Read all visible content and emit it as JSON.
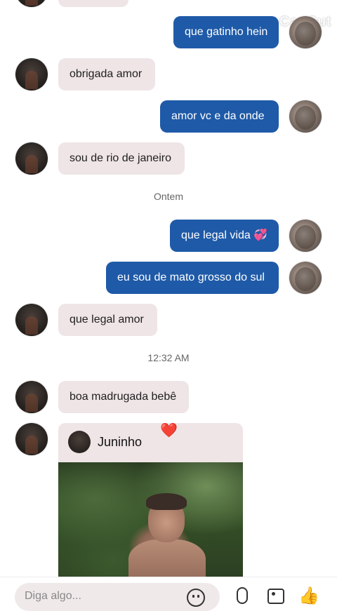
{
  "overlay": {
    "watermark": "CapCut"
  },
  "messages": {
    "m0": {
      "text": ""
    },
    "m1": {
      "text": "que gatinho hein"
    },
    "m2": {
      "text": "obrigada amor"
    },
    "m3": {
      "text": "amor vc e da onde"
    },
    "m4": {
      "text": "sou de rio de janeiro"
    },
    "ts1": {
      "text": "Ontem"
    },
    "m5": {
      "text": "que legal vida 💞"
    },
    "m6": {
      "text": "eu sou de mato grosso do sul"
    },
    "m7": {
      "text": "que legal amor"
    },
    "ts2": {
      "text": "12:32 AM"
    },
    "m8": {
      "text": "boa madrugada bebê"
    }
  },
  "shared_post": {
    "author": "Juninho",
    "reaction": "❤️"
  },
  "composer": {
    "placeholder": "Diga algo...",
    "icons": [
      "emoji-icon",
      "microphone-icon",
      "image-icon",
      "thumbs-up-icon"
    ]
  }
}
